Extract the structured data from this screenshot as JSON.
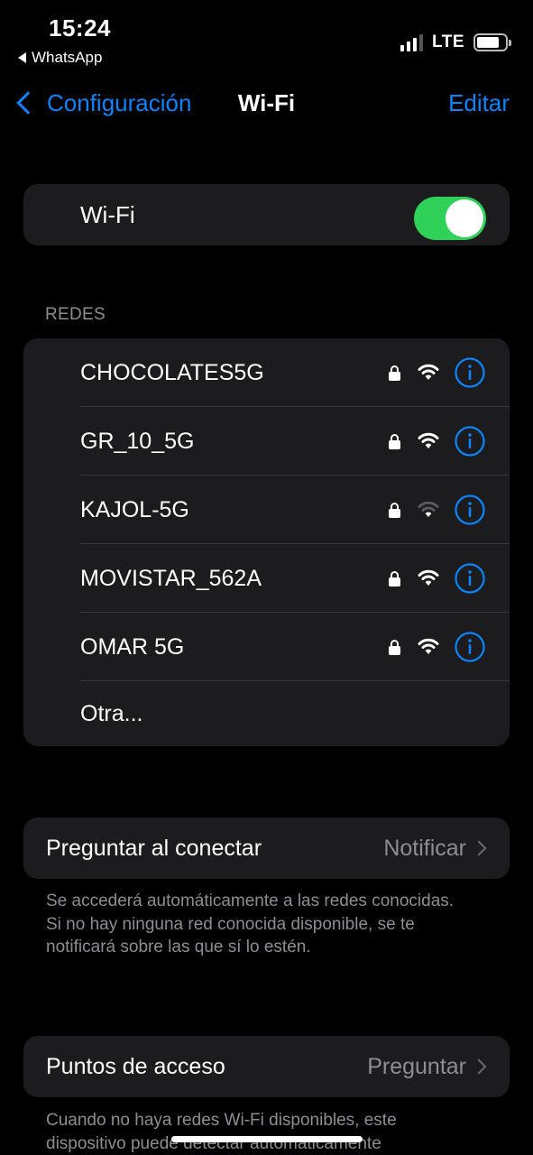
{
  "status_bar": {
    "time": "15:24",
    "back_app": "WhatsApp",
    "network_type": "LTE",
    "signal_bars_active": 3,
    "signal_bars_total": 4,
    "battery_level": 0.8
  },
  "nav": {
    "back_label": "Configuración",
    "title": "Wi-Fi",
    "edit_label": "Editar"
  },
  "wifi": {
    "label": "Wi-Fi",
    "enabled": true,
    "toggle_color": "#30d158"
  },
  "networks": {
    "header": "REDES",
    "items": [
      {
        "name": "CHOCOLATES5G",
        "locked": true,
        "signal_bars": 3
      },
      {
        "name": "GR_10_5G",
        "locked": true,
        "signal_bars": 3
      },
      {
        "name": "KAJOL-5G",
        "locked": true,
        "signal_bars": 1
      },
      {
        "name": "MOVISTAR_562A",
        "locked": true,
        "signal_bars": 3
      },
      {
        "name": "OMAR 5G",
        "locked": true,
        "signal_bars": 3
      }
    ],
    "other_label": "Otra..."
  },
  "ask_to_join": {
    "label": "Preguntar al conectar",
    "value": "Notificar",
    "footnote": "Se accederá automáticamente a las redes conocidas. Si no hay ninguna red conocida disponible, se te notificará sobre las que sí lo estén."
  },
  "hotspot": {
    "label": "Puntos de acceso",
    "value": "Preguntar",
    "footnote": "Cuando no haya redes Wi-Fi disponibles, este dispositivo puede detectar automáticamente"
  },
  "colors": {
    "accent": "#0a84ff",
    "background": "#000000",
    "group_background": "#1c1c1e",
    "secondary_text": "#8d8d93"
  }
}
